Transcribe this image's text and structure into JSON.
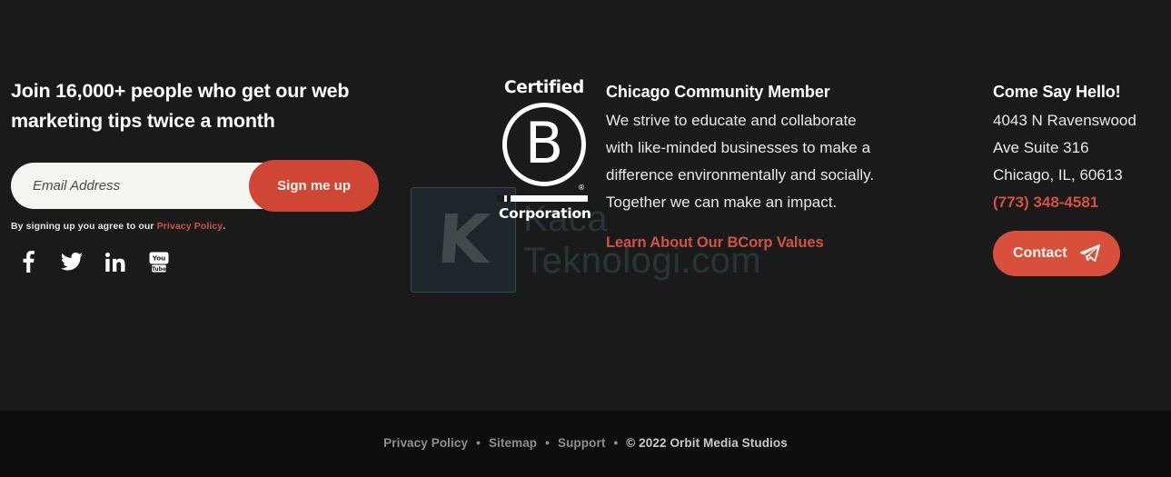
{
  "colors": {
    "background": "#1a1a1a",
    "footer_background": "#0d0d0d",
    "accent_red": "#cf4634",
    "link_red": "#d4523f",
    "text_white": "#ffffff",
    "text_muted": "#8e8e8e"
  },
  "signup": {
    "headline": "Join 16,000+ people who get our web marketing tips twice a month",
    "email_placeholder": "Email Address",
    "email_value": "",
    "submit_label": "Sign me up",
    "consent_prefix": "By signing up you agree to our ",
    "consent_link": "Privacy Policy",
    "consent_suffix": ".",
    "socials": [
      {
        "name": "facebook-icon",
        "label": "Facebook"
      },
      {
        "name": "twitter-icon",
        "label": "Twitter"
      },
      {
        "name": "linkedin-icon",
        "label": "LinkedIn"
      },
      {
        "name": "youtube-icon",
        "label": "YouTube"
      }
    ]
  },
  "bcorp": {
    "certified": "Certified",
    "letter": "B",
    "registered": "®",
    "corporation": "Corporation"
  },
  "community": {
    "title": "Chicago Community Member",
    "body": "We strive to educate and collaborate with like-minded businesses to make a difference environmentally and socially. Together we can make an impact.",
    "link": "Learn About Our BCorp Values"
  },
  "contact": {
    "title": "Come Say Hello!",
    "address_line1": "4043 N Ravenswood",
    "address_line2": "Ave Suite 316",
    "address_line3": "Chicago, IL, 60613",
    "phone": "(773) 348-4581",
    "button_label": "Contact",
    "button_icon": "paper-plane-icon"
  },
  "footer": {
    "links": [
      {
        "label": "Privacy Policy"
      },
      {
        "label": "Sitemap"
      },
      {
        "label": "Support"
      }
    ],
    "separator": "•",
    "copyright": "© 2022 Orbit Media Studios"
  },
  "watermark": {
    "mark": "K",
    "text": "Kaca\nTeknologi.com"
  }
}
